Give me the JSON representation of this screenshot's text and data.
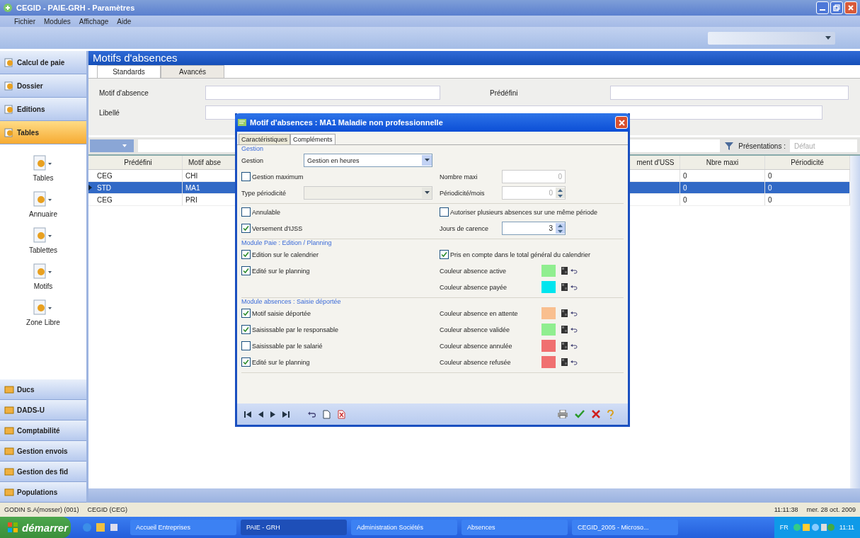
{
  "window": {
    "title": "CEGID - PAIE-GRH - Paramètres"
  },
  "menu": [
    "Fichier",
    "Modules",
    "Affichage",
    "Aide"
  ],
  "sidebar": {
    "top_items": [
      {
        "label": "Calcul de paie",
        "selected": false
      },
      {
        "label": "Dossier",
        "selected": false
      },
      {
        "label": "Editions",
        "selected": false
      },
      {
        "label": "Tables",
        "selected": true
      }
    ],
    "tools": [
      "Tables",
      "Annuaire",
      "Tablettes",
      "Motifs",
      "Zone Libre"
    ],
    "bottom_items": [
      {
        "label": "Ducs",
        "selected": false
      },
      {
        "label": "DADS-U",
        "selected": false
      },
      {
        "label": "Comptabilité",
        "selected": false
      },
      {
        "label": "Gestion envois",
        "selected": false
      },
      {
        "label": "Gestion des fid",
        "selected": false
      },
      {
        "label": "Populations",
        "selected": false
      }
    ]
  },
  "page": {
    "title": "Motifs d'absences",
    "tabs": [
      {
        "label": "Standards",
        "selected": true
      },
      {
        "label": "Avancés",
        "selected": false
      }
    ],
    "filters": {
      "motif_label": "Motif d'absence",
      "predefini_label": "Prédéfini",
      "libelle_label": "Libellé"
    },
    "presentations": {
      "label": "Présentations :",
      "value": "Défaut"
    }
  },
  "table": {
    "columns": [
      "Prédéfini",
      "Motif abse",
      "ment d'USS",
      "Nbre maxi",
      "Périodicité"
    ],
    "rows": [
      {
        "cells": [
          "CEG",
          "CHI",
          "",
          "0",
          "0"
        ],
        "selected": false
      },
      {
        "cells": [
          "STD",
          "MA1",
          "",
          "0",
          "0"
        ],
        "selected": true
      },
      {
        "cells": [
          "CEG",
          "PRI",
          "",
          "0",
          "0"
        ],
        "selected": false
      }
    ]
  },
  "dialog": {
    "title": "Motif d'absences : MA1 Maladie non professionnelle",
    "tabs": [
      {
        "label": "Caractéristiques",
        "selected": false
      },
      {
        "label": "Compléments",
        "selected": true
      }
    ],
    "sections": [
      {
        "title": "Gestion",
        "rows": [
          {
            "left": {
              "kind": "select",
              "label": "Gestion",
              "value": "Gestion en heures",
              "disabled": false
            },
            "right": null
          },
          {
            "left": {
              "kind": "checkbox",
              "label": "Gestion maximum",
              "checked": false
            },
            "right": {
              "kind": "number",
              "label": "Nombre maxi",
              "value": "0",
              "spinner": false,
              "disabled": true
            }
          },
          {
            "left": {
              "kind": "select",
              "label": "Type périodicité",
              "disabled": true
            },
            "right": {
              "kind": "number",
              "label": "Périodicité/mois",
              "value": "0",
              "spinner": true,
              "disabled": true
            }
          }
        ]
      },
      {
        "rows": [
          {
            "left": {
              "kind": "checkbox",
              "label": "Annulable",
              "checked": false
            },
            "right": {
              "kind": "checkbox",
              "label": "Autoriser plusieurs absences sur une même période",
              "checked": false
            }
          },
          {
            "left": {
              "kind": "checkbox",
              "label": "Versement d'IJSS",
              "checked": true
            },
            "right": {
              "kind": "number",
              "label": "Jours de carence",
              "value": "3",
              "spinner": true,
              "disabled": false
            }
          }
        ]
      },
      {
        "title": "Module Paie : Edition / Planning",
        "rows": [
          {
            "left": {
              "kind": "checkbox",
              "label": "Edition sur le calendrier",
              "checked": true
            },
            "right": {
              "kind": "checkbox",
              "label": "Pris en compte dans le total général du calendrier",
              "checked": true
            }
          },
          {
            "left": {
              "kind": "checkbox",
              "label": "Edité sur le planning",
              "checked": true
            },
            "right": {
              "kind": "color",
              "label": "Couleur absence active",
              "color": "#90ee90"
            }
          },
          {
            "left": null,
            "right": {
              "kind": "color",
              "label": "Couleur absence payée",
              "color": "#00e5ee"
            }
          }
        ]
      },
      {
        "title": "Module absences : Saisie déportée",
        "rows": [
          {
            "left": {
              "kind": "checkbox",
              "label": "Motif saisie déportée",
              "checked": true
            },
            "right": {
              "kind": "color",
              "label": "Couleur absence en attente",
              "color": "#f9bf8f"
            }
          },
          {
            "left": {
              "kind": "checkbox",
              "label": "Saisissable par le responsable",
              "checked": true
            },
            "right": {
              "kind": "color",
              "label": "Couleur absence validée",
              "color": "#90ee90"
            }
          },
          {
            "left": {
              "kind": "checkbox",
              "label": "Saisissable par le salarié",
              "checked": false
            },
            "right": {
              "kind": "color",
              "label": "Couleur absence annulée",
              "color": "#f07070"
            }
          },
          {
            "left": {
              "kind": "checkbox",
              "label": "Edité sur le planning",
              "checked": true
            },
            "right": {
              "kind": "color",
              "label": "Couleur absence refusée",
              "color": "#f07070"
            }
          }
        ]
      }
    ]
  },
  "status_bar": {
    "user": "GODIN S.A(mosser) (001)",
    "company": "CEGID (CEG)",
    "time": "11:11:38",
    "date": "mer. 28 oct. 2009"
  },
  "taskbar": {
    "start": "démarrer",
    "tasks": [
      {
        "label": "Accueil Entreprises",
        "selected": false
      },
      {
        "label": "PAIE - GRH",
        "selected": true
      },
      {
        "label": "Administration Sociétés",
        "selected": false
      },
      {
        "label": "Absences",
        "selected": false
      },
      {
        "label": "CEGID_2005 - Microso...",
        "selected": false
      }
    ],
    "lang": "FR",
    "clock": "11:11"
  }
}
